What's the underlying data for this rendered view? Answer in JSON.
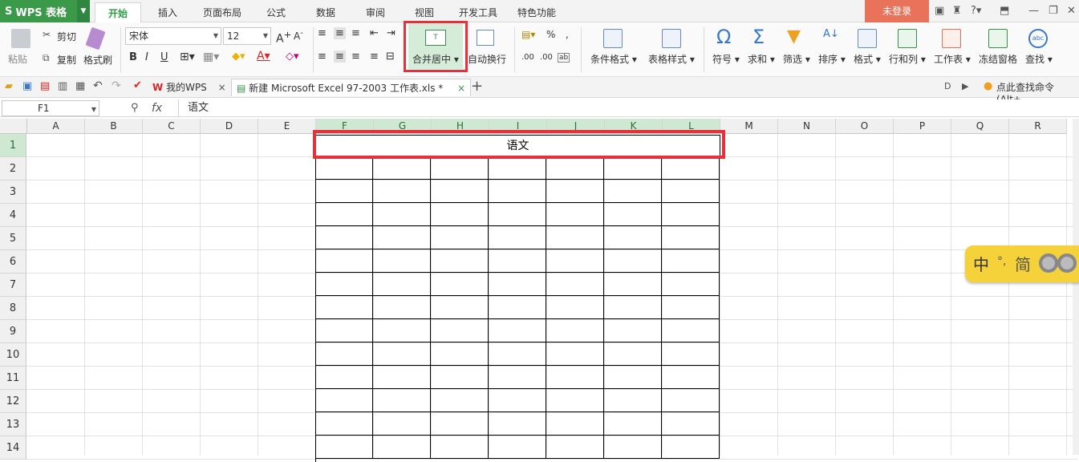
{
  "app": {
    "name": "WPS 表格",
    "login": "未登录"
  },
  "menu": [
    "开始",
    "插入",
    "页面布局",
    "公式",
    "数据",
    "审阅",
    "视图",
    "开发工具",
    "特色功能"
  ],
  "ribbon": {
    "paste": "粘贴",
    "cut": "剪切",
    "copy": "复制",
    "format_painter": "格式刷",
    "font_name": "宋体",
    "font_size": "12",
    "merge_center": "合并居中",
    "wrap_text": "自动换行",
    "conditional_format": "条件格式",
    "table_style": "表格样式",
    "symbol": "符号",
    "sum": "求和",
    "filter": "筛选",
    "sort": "排序",
    "format": "格式",
    "row_col": "行和列",
    "worksheet": "工作表",
    "freeze": "冻结窗格",
    "find": "查找"
  },
  "tabs": {
    "mywps": "我的WPS",
    "document": "新建 Microsoft Excel 97-2003 工作表.xls *",
    "search_cmd": "点此查找命令 (Alt+"
  },
  "formula_bar": {
    "cell_ref": "F1",
    "fx": "fx",
    "value": "语文"
  },
  "sheet": {
    "columns": [
      "A",
      "B",
      "C",
      "D",
      "E",
      "F",
      "G",
      "H",
      "I",
      "J",
      "K",
      "L",
      "M",
      "N",
      "O",
      "P",
      "Q",
      "R"
    ],
    "rows": [
      "1",
      "2",
      "3",
      "4",
      "5",
      "6",
      "7",
      "8",
      "9",
      "10",
      "11",
      "12",
      "13",
      "14"
    ],
    "merged_text": "语文"
  },
  "ime": {
    "lang": "中",
    "punct": "°,",
    "mode": "简"
  },
  "colors": {
    "accent": "#2e9c45",
    "highlight": "#e8303a",
    "login": "#e8725a"
  }
}
